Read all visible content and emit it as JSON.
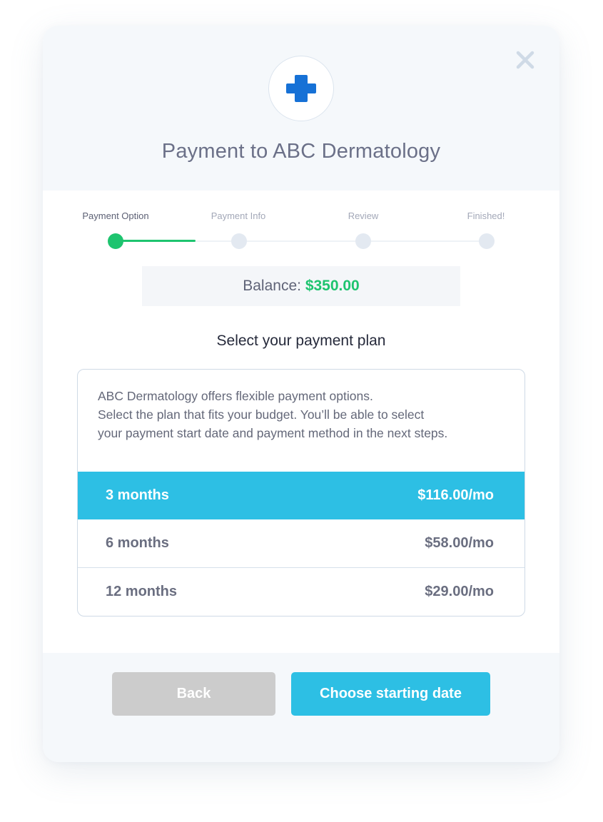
{
  "header": {
    "title": "Payment to ABC Dermatology",
    "logo_icon": "medical-cross-icon",
    "close_icon": "close-icon"
  },
  "stepper": {
    "steps": [
      {
        "label": "Payment Option",
        "state": "active"
      },
      {
        "label": "Payment Info",
        "state": "pending"
      },
      {
        "label": "Review",
        "state": "pending"
      },
      {
        "label": "Finished!",
        "state": "pending"
      }
    ]
  },
  "balance": {
    "label": "Balance:",
    "amount": "$350.00"
  },
  "plan_heading": "Select your payment plan",
  "plan_card": {
    "description_lines": [
      "ABC Dermatology offers flexible payment options.",
      "Select the plan that fits your budget. You’ll be able to select",
      "your payment start date and payment method in the next steps."
    ],
    "options": [
      {
        "term": "3 months",
        "price": "$116.00/mo",
        "selected": true
      },
      {
        "term": "6 months",
        "price": "$58.00/mo",
        "selected": false
      },
      {
        "term": "12 months",
        "price": "$29.00/mo",
        "selected": false
      }
    ]
  },
  "footer": {
    "back_label": "Back",
    "next_label": "Choose starting date"
  },
  "colors": {
    "accent_blue": "#2dbfe4",
    "success_green": "#1ec46f",
    "logo_blue": "#1671d6",
    "disabled_gray": "#cccccc"
  }
}
